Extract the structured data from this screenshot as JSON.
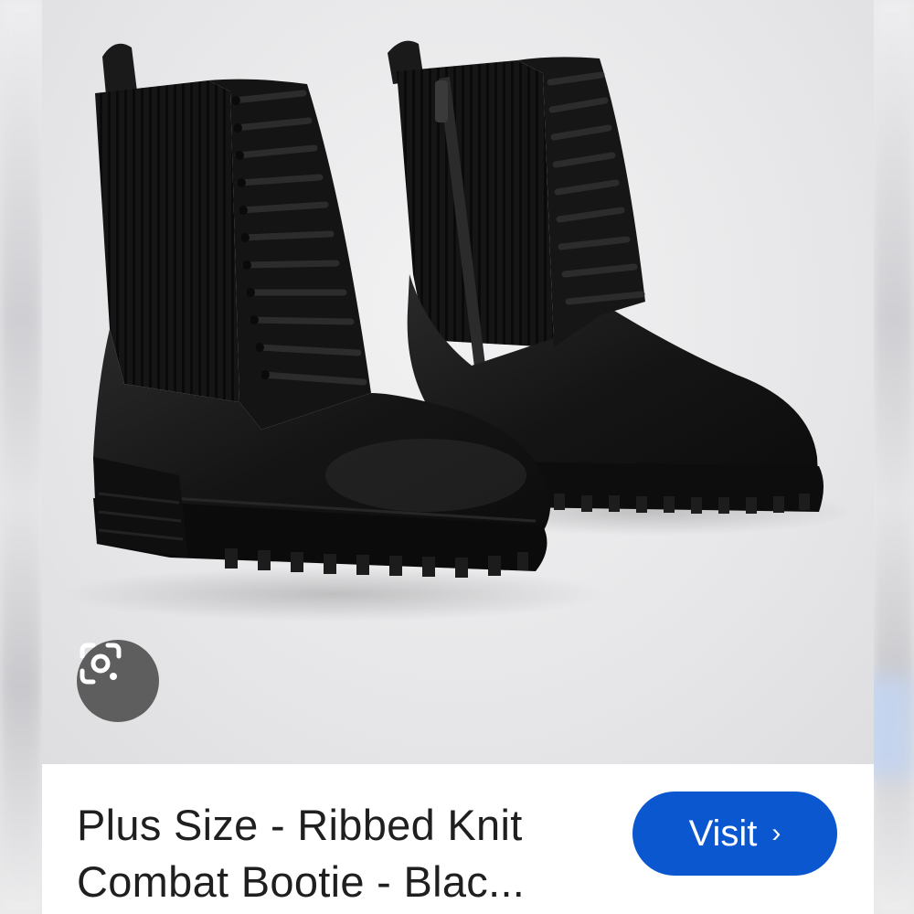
{
  "product": {
    "title_line1": "Plus Size - Ribbed Knit",
    "title_line2": "Combat Bootie - Blac...",
    "visit_label": "Visit",
    "visit_chevron": "›"
  },
  "icons": {
    "lens": "google-lens-icon",
    "visit_chevron": "chevron-right-icon"
  },
  "colors": {
    "visit_button": "#0b57d0",
    "lens_button": "#5e5e5e",
    "title_text": "#1f1f1f"
  }
}
